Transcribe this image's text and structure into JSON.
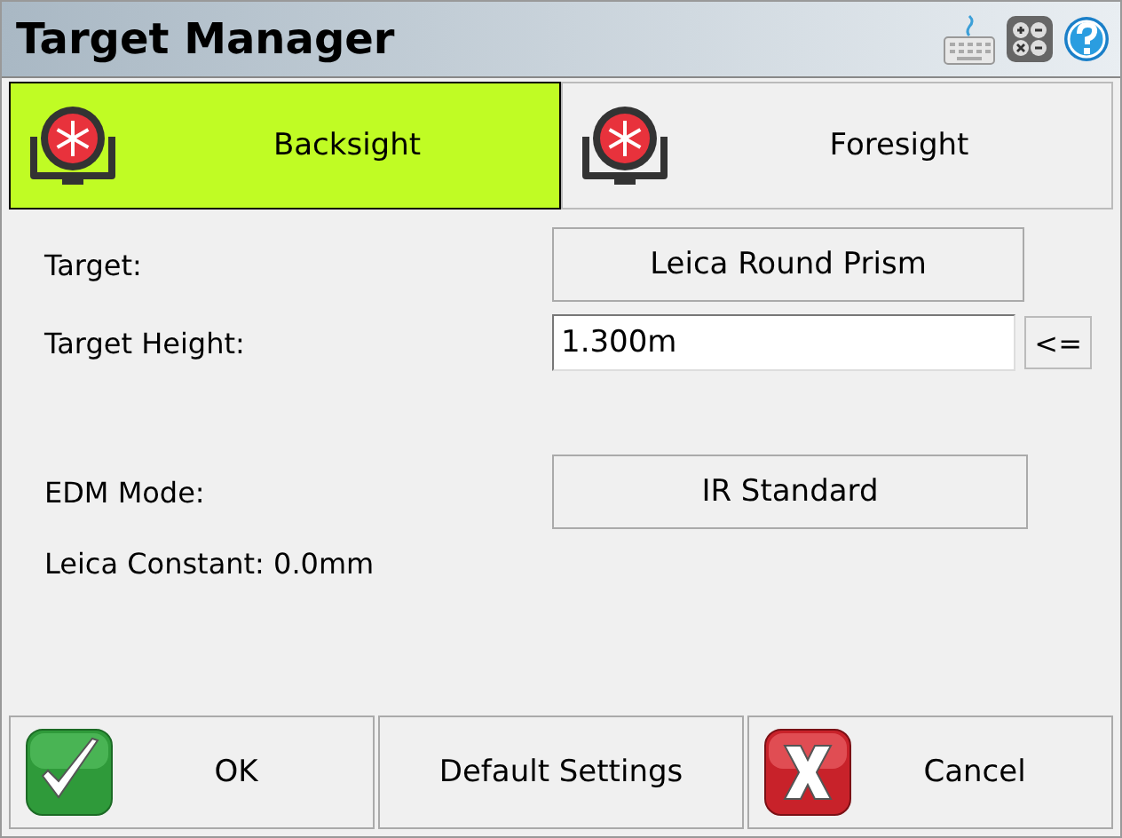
{
  "window": {
    "title": "Target Manager"
  },
  "tabs": [
    {
      "label": "Backsight",
      "selected": true
    },
    {
      "label": "Foresight",
      "selected": false
    }
  ],
  "form": [
    {
      "kind": "button",
      "label": "Target:",
      "value": "Leica Round Prism"
    },
    {
      "kind": "input",
      "label": "Target Height:",
      "value": "1.300m",
      "action": "<="
    },
    {
      "kind": "button",
      "label": "EDM Mode:",
      "value": "IR Standard"
    },
    {
      "kind": "text",
      "label": "Leica Constant: 0.0mm"
    }
  ],
  "buttons": [
    {
      "kind": "ok",
      "label": "OK"
    },
    {
      "kind": "plain",
      "label": "Default Settings"
    },
    {
      "kind": "cancel",
      "label": "Cancel"
    }
  ]
}
